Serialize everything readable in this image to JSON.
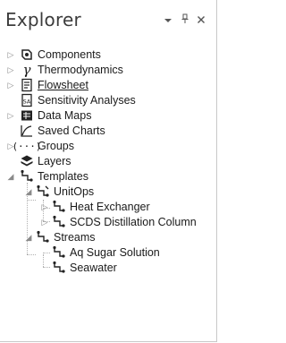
{
  "panel": {
    "title": "Explorer",
    "dropdown_icon": "chevron-down-icon",
    "pin_icon": "pin-icon",
    "close_icon": "close-icon"
  },
  "tree": {
    "components": "Components",
    "thermodynamics": "Thermodynamics",
    "flowsheet": "Flowsheet",
    "sensitivity": "Sensitivity Analyses",
    "data_maps": "Data Maps",
    "saved_charts": "Saved Charts",
    "groups": "Groups",
    "layers": "Layers",
    "templates": "Templates",
    "unitops": "UnitOps",
    "heat_exchanger": "Heat Exchanger",
    "scds": "SCDS Distillation Column",
    "streams": "Streams",
    "aq_sugar": "Aq Sugar Solution",
    "seawater": "Seawater"
  }
}
